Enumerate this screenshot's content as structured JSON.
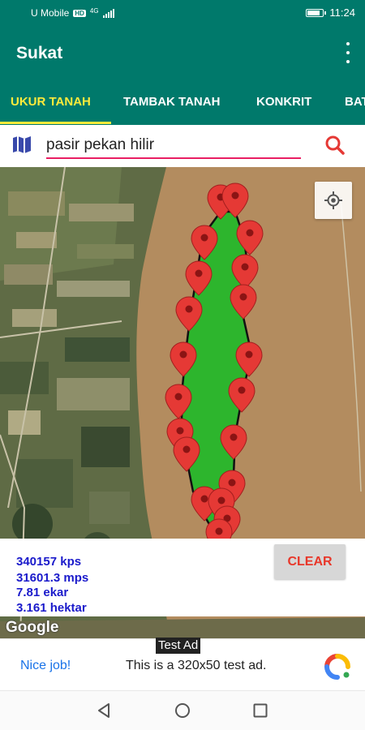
{
  "status_bar": {
    "carrier": "U Mobile",
    "network_badge": "HD",
    "network_type": "4G",
    "time": "11:24"
  },
  "app_bar": {
    "title": "Sukat",
    "menu_icon": "overflow-menu-icon"
  },
  "tabs": [
    {
      "label": "UKUR TANAH",
      "active": true
    },
    {
      "label": "TAMBAK TANAH",
      "active": false
    },
    {
      "label": "KONKRIT",
      "active": false
    },
    {
      "label": "BAT",
      "active": false
    }
  ],
  "search": {
    "value": "pasir pekan hilir",
    "map_icon": "map-icon",
    "search_icon": "search-icon"
  },
  "map": {
    "attribution": "Google",
    "my_location_icon": "my-location-icon",
    "polygon_color": "#2db52d",
    "marker_color": "#e53935",
    "marker_count": 26
  },
  "measurements": {
    "kps": "340157 kps",
    "mps": "31601.3 mps",
    "ekar": "7.81 ekar",
    "hektar": "3.161 hektar"
  },
  "clear_button": "CLEAR",
  "ad": {
    "tag": "Test Ad",
    "cta": "Nice job!",
    "text": "This is a 320x50 test ad.",
    "logo_icon": "admob-logo-icon"
  },
  "nav_bar": {
    "back_icon": "back-triangle-icon",
    "home_icon": "home-circle-icon",
    "recents_icon": "recents-square-icon"
  },
  "colors": {
    "primary": "#00796b",
    "accent": "#ffeb3b",
    "search_underline": "#e91e63",
    "measurement_text": "#1a1acb",
    "clear_text": "#e8372a"
  }
}
